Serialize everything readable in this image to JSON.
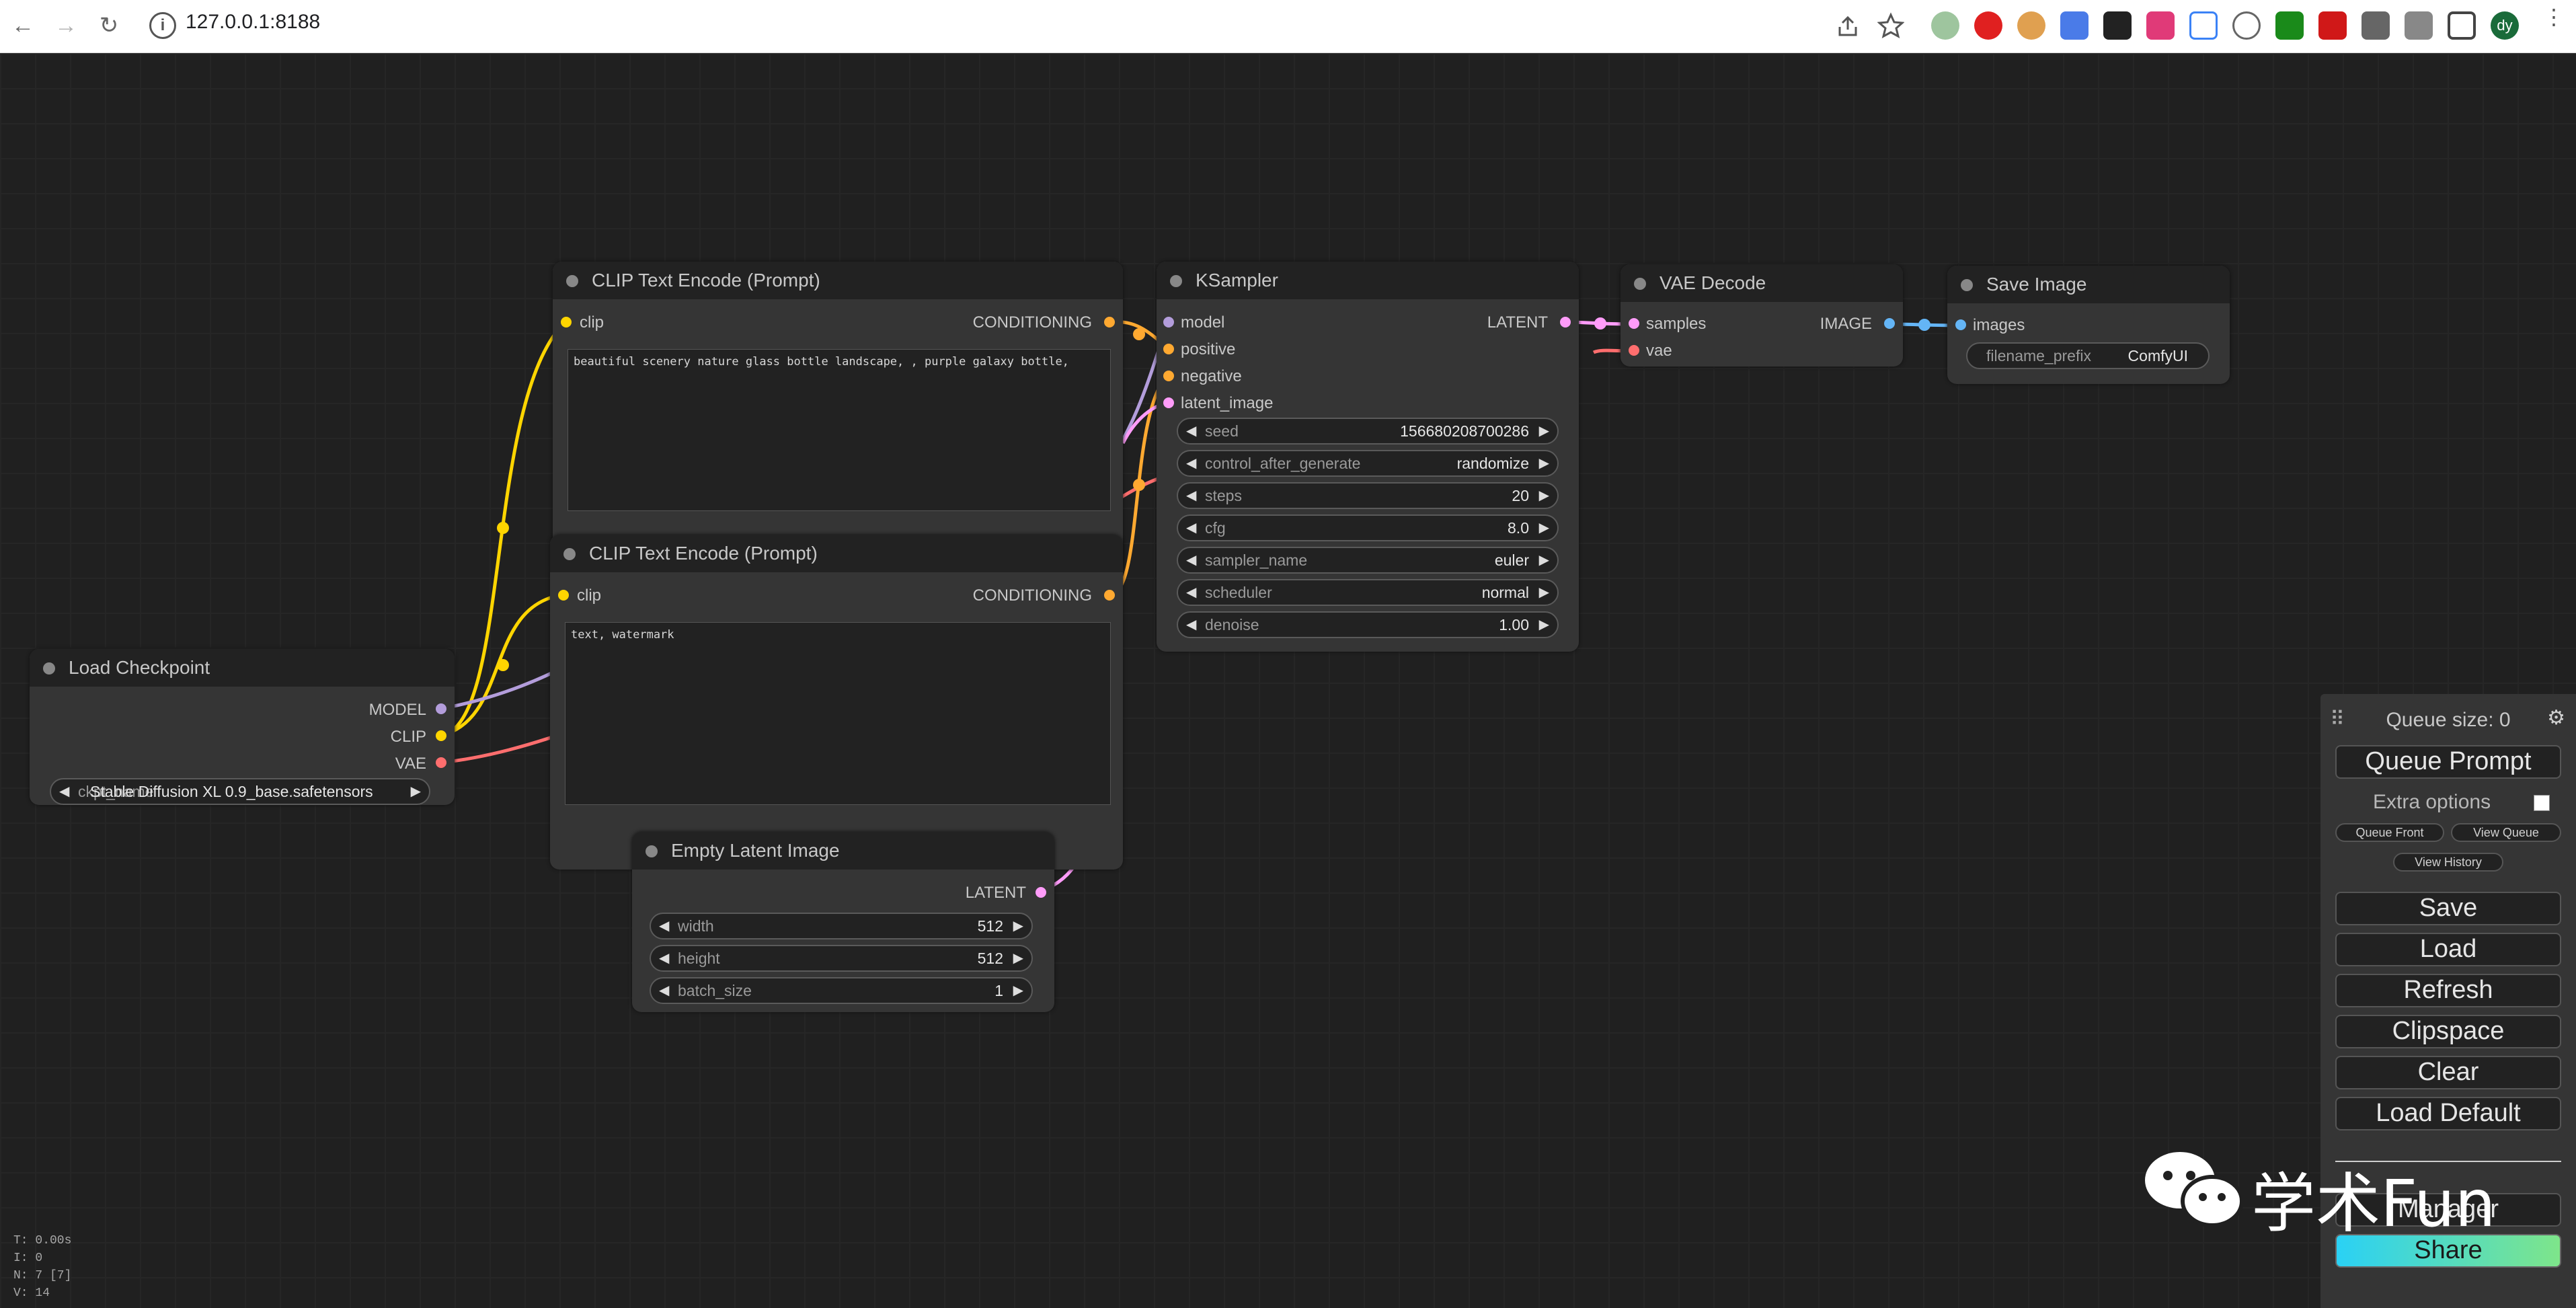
{
  "browser": {
    "url": "127.0.0.1:8188",
    "back_icon": "←",
    "forward_icon": "→",
    "reload_icon": "↻",
    "profile_initials": "dy"
  },
  "nodes": {
    "clip_encode_pos": {
      "title": "CLIP Text Encode (Prompt)",
      "input_clip": "clip",
      "output": "CONDITIONING",
      "text": "beautiful scenery nature glass bottle landscape, , purple galaxy bottle,"
    },
    "clip_encode_neg": {
      "title": "CLIP Text Encode (Prompt)",
      "input_clip": "clip",
      "output": "CONDITIONING",
      "text": "text, watermark"
    },
    "load_checkpoint": {
      "title": "Load Checkpoint",
      "outputs": [
        "MODEL",
        "CLIP",
        "VAE"
      ],
      "ckpt_label": "ckpt_name",
      "ckpt_value": "Stable Diffusion XL 0.9_base.safetensors"
    },
    "ksampler": {
      "title": "KSampler",
      "inputs": [
        "model",
        "positive",
        "negative",
        "latent_image"
      ],
      "output": "LATENT",
      "widgets": [
        {
          "label": "seed",
          "value": "156680208700286"
        },
        {
          "label": "control_after_generate",
          "value": "randomize"
        },
        {
          "label": "steps",
          "value": "20"
        },
        {
          "label": "cfg",
          "value": "8.0"
        },
        {
          "label": "sampler_name",
          "value": "euler"
        },
        {
          "label": "scheduler",
          "value": "normal"
        },
        {
          "label": "denoise",
          "value": "1.00"
        }
      ]
    },
    "vae_decode": {
      "title": "VAE Decode",
      "inputs": [
        "samples",
        "vae"
      ],
      "output": "IMAGE"
    },
    "save_image": {
      "title": "Save Image",
      "input": "images",
      "widget_label": "filename_prefix",
      "widget_value": "ComfyUI"
    },
    "empty_latent": {
      "title": "Empty Latent Image",
      "output": "LATENT",
      "widgets": [
        {
          "label": "width",
          "value": "512"
        },
        {
          "label": "height",
          "value": "512"
        },
        {
          "label": "batch_size",
          "value": "1"
        }
      ]
    }
  },
  "queue_panel": {
    "queue_size": "Queue size: 0",
    "queue_prompt": "Queue Prompt",
    "extra_options": "Extra options",
    "queue_front": "Queue Front",
    "view_queue": "View Queue",
    "view_history": "View History",
    "save": "Save",
    "load": "Load",
    "refresh": "Refresh",
    "clipspace": "Clipspace",
    "clear": "Clear",
    "load_default": "Load Default",
    "manager": "Manager",
    "share": "Share"
  },
  "stats": {
    "t": "T: 0.00s",
    "i": "I: 0",
    "n": "N: 7 [7]",
    "v": "V: 14"
  },
  "watermark": {
    "text": "学术Fun"
  },
  "colors": {
    "clip_link": "#ffd500",
    "model_link": "#b39ddb",
    "vae_link": "#ff6e6e",
    "conditioning_link": "#ffa931",
    "latent_link": "#ff9cf9",
    "image_link": "#64b5f6",
    "share_gradient_start": "#2ad1f5",
    "share_gradient_end": "#7ee58a"
  }
}
